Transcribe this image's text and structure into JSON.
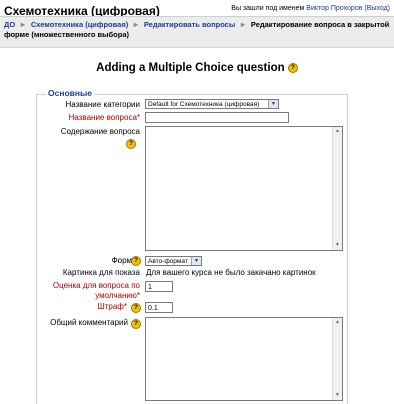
{
  "header": {
    "course_title": "Схемотехника (цифровая)",
    "login_prefix": "Вы зашли под именем",
    "user_name": "Виктор Прохоров",
    "logout": "(Выход)"
  },
  "breadcrumb": {
    "items": [
      "ДО",
      "Схемотехника (цифровая)",
      "Редактировать вопросы"
    ],
    "current": "Редактирование вопроса в закрытой форме (множественного выбора)",
    "separator": "►"
  },
  "page": {
    "heading": "Adding a Multiple Choice question",
    "help_glyph": "?"
  },
  "form": {
    "legend": "Основные",
    "category_label": "Название категории",
    "category_value": "Default for Схемотехника (цифровая)",
    "name_label": "Название вопроса*",
    "name_value": "",
    "content_label": "Содержание вопроса",
    "format_label": "Формат",
    "format_value": "Авто-формат",
    "image_label": "Картинка для показа",
    "image_value": "Для вашего курса не было закачано картинок",
    "grade_label": "Оценка для вопроса по умолчанию*",
    "grade_value": "1",
    "penalty_label": "Штраф*",
    "penalty_value": "0.1",
    "feedback_label": "Общий комментарий"
  },
  "icons": {
    "dropdown": "▼",
    "scroll_up": "▲",
    "scroll_down": "▼"
  },
  "colors": {
    "link": "#1f3a9c",
    "required": "#b00000",
    "help": "#f2c200"
  }
}
